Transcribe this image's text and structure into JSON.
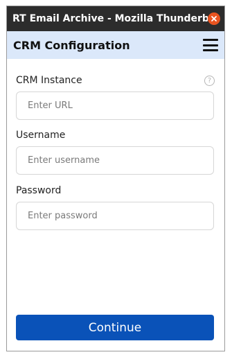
{
  "window": {
    "title": "RT Email Archive - Mozilla Thunderbird",
    "close_icon": "close-icon"
  },
  "header": {
    "title": "CRM Configuration",
    "menu_icon": "hamburger-menu-icon"
  },
  "form": {
    "crm_instance": {
      "label": "CRM Instance",
      "placeholder": "Enter URL",
      "value": "",
      "help_icon": "help-icon",
      "help_glyph": "?"
    },
    "username": {
      "label": "Username",
      "placeholder": "Enter username",
      "value": ""
    },
    "password": {
      "label": "Password",
      "placeholder": "Enter password",
      "value": ""
    }
  },
  "actions": {
    "continue_label": "Continue"
  },
  "colors": {
    "titlebar": "#2c2c2c",
    "header_bg": "#dbe8fa",
    "close_button": "#e95420",
    "primary_button": "#0a52b8"
  }
}
